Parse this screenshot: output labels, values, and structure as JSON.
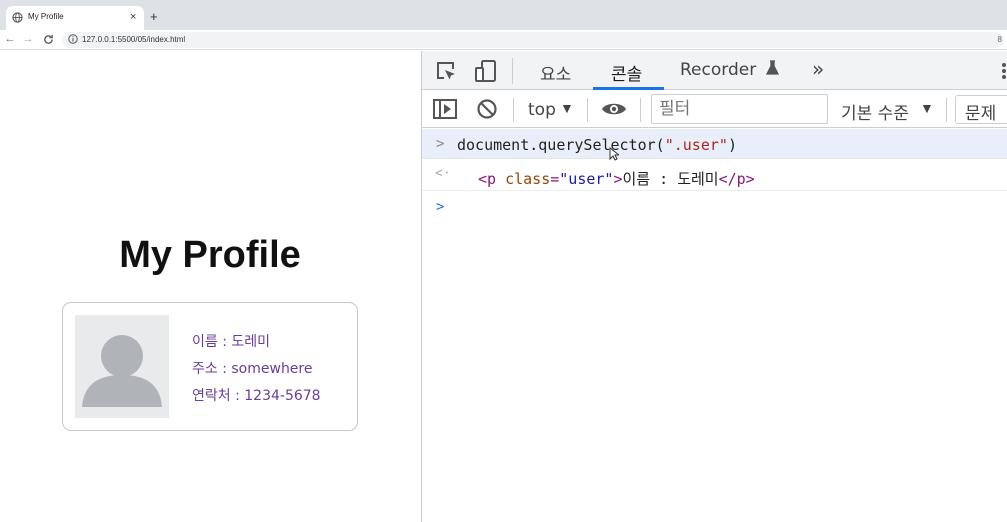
{
  "browser": {
    "tab_title": "My Profile",
    "tab_close": "×",
    "new_tab": "+",
    "nav": {
      "back": "←",
      "forward": "→",
      "reload": "C"
    },
    "url": "127.0.0.1:5500/05/index.html",
    "omnibox_edge": "8"
  },
  "page": {
    "heading": "My Profile",
    "profile": {
      "name_line": "이름 : 도레미",
      "address_line": "주소 : somewhere",
      "phone_line": "연락처 : 1234-5678"
    }
  },
  "devtools": {
    "tabs": {
      "elements": "요소",
      "console": "콘솔",
      "recorder": "Recorder",
      "more": "»"
    },
    "toolbar": {
      "context": "top",
      "context_caret": "▼",
      "filter_placeholder": "필터",
      "levels": "기본 수준",
      "levels_caret": "▼",
      "issues": "문제"
    },
    "console": {
      "input_chevron": ">",
      "input_code_prefix": "document.querySelector(",
      "input_code_string": "\".user\"",
      "input_code_suffix": ")",
      "output_arrow": "<·",
      "output_tag_open": "<p ",
      "output_attr": "class",
      "output_eq": "=",
      "output_attr_value": "\"user\"",
      "output_tag_close_bracket": ">",
      "output_text": "이름 : 도레미",
      "output_end_tag": "</p>",
      "prompt_chevron": ">"
    }
  },
  "colors": {
    "accent": "#1a73e8",
    "profile_text": "#6a3d9a",
    "string": "#b0261b",
    "tag": "#88177b",
    "attr": "#994500",
    "attr_value": "#1a1aa6"
  },
  "icons": [
    "globe-icon",
    "info-icon",
    "inspect-icon",
    "device-toolbar-icon",
    "flask-icon",
    "kebab-icon",
    "sidebar-icon",
    "clear-console-icon",
    "eye-icon",
    "avatar-placeholder-icon",
    "mouse-cursor-icon"
  ]
}
